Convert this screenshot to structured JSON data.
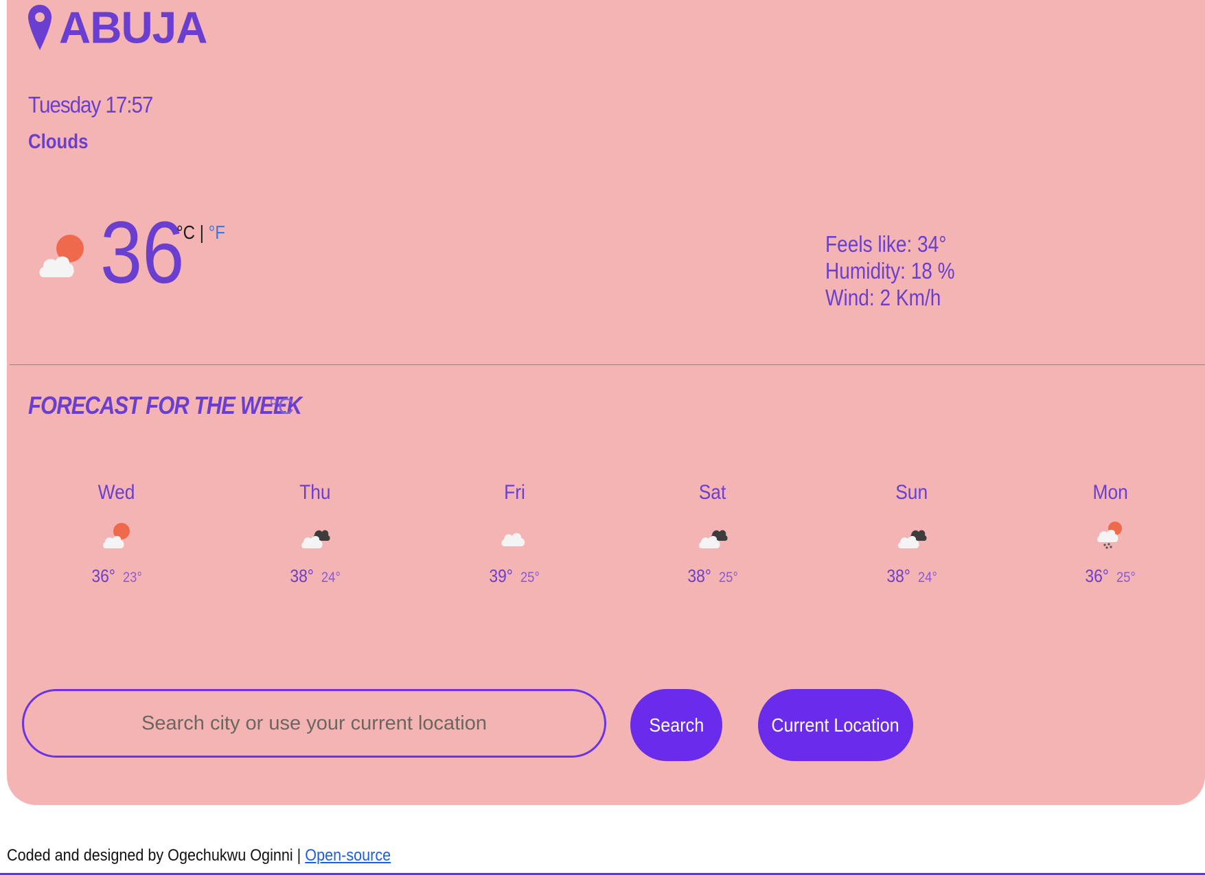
{
  "location": {
    "city": "ABUJA",
    "datetime": "Tuesday 17:57",
    "condition": "Clouds"
  },
  "current": {
    "temperature": "36",
    "unit_c": "°C",
    "unit_separator": "|",
    "unit_f": "°F",
    "icon": "cloud-sun-icon"
  },
  "details": {
    "feels_like": "Feels like: 34°",
    "humidity": "Humidity: 18 %",
    "wind": "Wind: 2 Km/h"
  },
  "forecast": {
    "title": "FORECAST FOR THE WEEK",
    "unit": "°C",
    "days": [
      {
        "day": "Wed",
        "max": "36°",
        "min": "23°",
        "icon": "cloud-sun-icon"
      },
      {
        "day": "Thu",
        "max": "38°",
        "min": "24°",
        "icon": "cloud-dark-icon"
      },
      {
        "day": "Fri",
        "max": "39°",
        "min": "25°",
        "icon": "cloud-icon"
      },
      {
        "day": "Sat",
        "max": "38°",
        "min": "25°",
        "icon": "cloud-dark-icon"
      },
      {
        "day": "Sun",
        "max": "38°",
        "min": "24°",
        "icon": "cloud-dark-icon"
      },
      {
        "day": "Mon",
        "max": "36°",
        "min": "25°",
        "icon": "cloud-sun-rain-icon"
      }
    ]
  },
  "search": {
    "placeholder": "Search city or use your current location",
    "search_label": "Search",
    "location_label": "Current Location"
  },
  "footer": {
    "text": "Coded and designed by Ogechukwu Oginni | ",
    "link_text": "Open-source"
  },
  "colors": {
    "card_background": "#f4b4b4",
    "primary_text": "#6a3fd0",
    "button": "#6a2cea",
    "link": "#2f7bf0",
    "sun": "#ef6a4c"
  }
}
